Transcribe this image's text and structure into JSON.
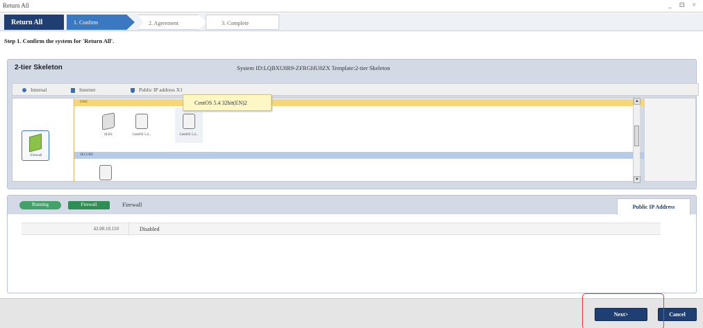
{
  "window": {
    "title": "Return All",
    "controls": "_ ⊡ ×"
  },
  "wizard": {
    "title": "Return All",
    "steps": [
      {
        "label": "1. Confirm"
      },
      {
        "label": "2. Agreement"
      },
      {
        "label": "3. Complete"
      }
    ],
    "step_description": "Step 1. Confirm the system for 'Return All'."
  },
  "system": {
    "name": "2-tier Skeleton",
    "info": "System ID:LQBXU8R9-ZFRGHU8ZX  Template:2-tier Skeleton"
  },
  "legend": [
    {
      "label": "Internal",
      "icon": "internal-icon"
    },
    {
      "label": "Internet",
      "icon": "internet-icon"
    },
    {
      "label": "Public IP address X1",
      "icon": "public-ip-icon"
    }
  ],
  "topology": {
    "firewall_label": "Firewall",
    "segments": {
      "dmz": "DMZ",
      "secure": "SECURE"
    },
    "nodes": [
      {
        "label": "SLB1",
        "icon": "load-balancer-icon"
      },
      {
        "label": "CentOS 5.4...",
        "icon": "server-icon"
      },
      {
        "label": "CentOS 5.4...",
        "icon": "server-icon"
      }
    ],
    "tooltip": "CentOS 5.4 32bit(EN)2"
  },
  "detail": {
    "status": "Running",
    "type": "Firewall",
    "name": "Firewall",
    "tab": "Public IP Address",
    "row": {
      "ip": "42.00.10.110",
      "value": "Disabled"
    }
  },
  "footer": {
    "next": "Next>",
    "cancel": "Cancel"
  },
  "colors": {
    "primary": "#1f3f72",
    "accent": "#3b78c2",
    "running": "#43a26a",
    "highlight": "#e53935"
  }
}
